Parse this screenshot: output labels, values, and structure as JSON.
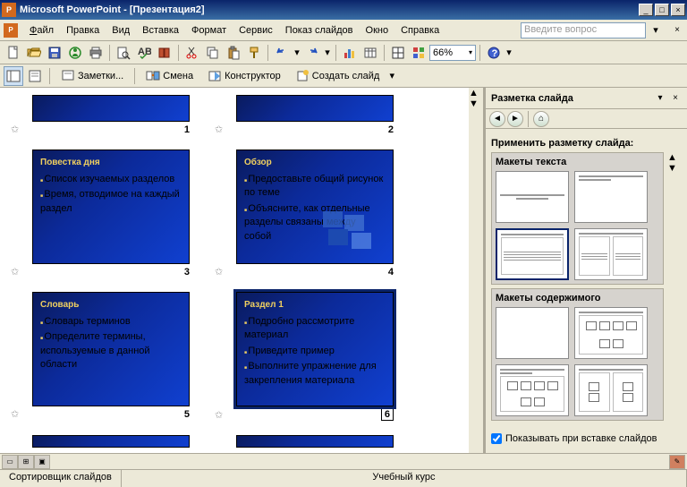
{
  "window": {
    "title": "Microsoft PowerPoint - [Презентация2]"
  },
  "menu": {
    "file": "Файл",
    "edit": "Правка",
    "view": "Вид",
    "insert": "Вставка",
    "format": "Формат",
    "service": "Сервис",
    "slideshow": "Показ слайдов",
    "window": "Окно",
    "help": "Справка",
    "helpbox": "Введите вопрос"
  },
  "toolbar": {
    "zoom": "66%"
  },
  "toolbar2": {
    "notes": "Заметки...",
    "change": "Смена",
    "designer": "Конструктор",
    "newslide": "Создать слайд"
  },
  "slides": [
    {
      "num": "1",
      "title": "",
      "body": []
    },
    {
      "num": "2",
      "title": "",
      "body": []
    },
    {
      "num": "3",
      "title": "Повестка дня",
      "body": [
        "Список изучаемых разделов",
        "Время, отводимое на каждый раздел"
      ]
    },
    {
      "num": "4",
      "title": "Обзор",
      "body": [
        "Предоставьте общий рисунок по теме",
        "Объясните, как отдельные разделы связаны между собой"
      ]
    },
    {
      "num": "5",
      "title": "Словарь",
      "body": [
        "Словарь терминов",
        "Определите термины, используемые в данной области"
      ]
    },
    {
      "num": "6",
      "title": "Раздел 1",
      "body": [
        "Подробно рассмотрите материал",
        "Приведите пример",
        "Выполните упражнение для закрепления материала"
      ]
    }
  ],
  "taskpane": {
    "title": "Разметка слайда",
    "apply": "Применить разметку слайда:",
    "group1": "Макеты текста",
    "group2": "Макеты содержимого",
    "checkbox": "Показывать при вставке слайдов"
  },
  "status": {
    "sorter": "Сортировщик слайдов",
    "course": "Учебный курс"
  }
}
